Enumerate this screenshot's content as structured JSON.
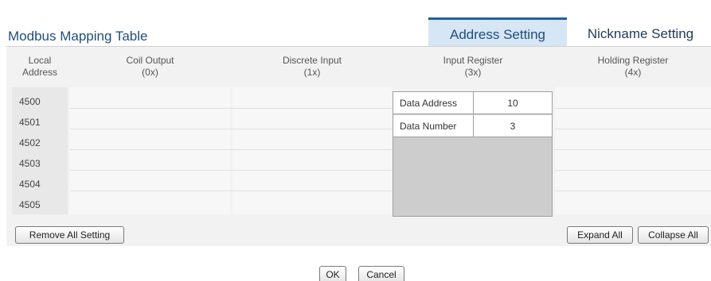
{
  "title": "Modbus Mapping Table",
  "tabs": [
    {
      "label": "Address Setting",
      "active": true
    },
    {
      "label": "Nickname Setting",
      "active": false
    }
  ],
  "columns": {
    "local": {
      "line1": "Local",
      "line2": "Address"
    },
    "coil": {
      "line1": "Coil Output",
      "line2": "(0x)"
    },
    "discrete": {
      "line1": "Discrete Input",
      "line2": "(1x)"
    },
    "input": {
      "line1": "Input Register",
      "line2": "(3x)"
    },
    "holding": {
      "line1": "Holding Register",
      "line2": "(4x)"
    }
  },
  "rows": [
    "4500",
    "4501",
    "4502",
    "4503",
    "4504",
    "4505"
  ],
  "input_register_config": {
    "data_address_label": "Data Address",
    "data_address_value": "10",
    "data_number_label": "Data Number",
    "data_number_value": "3"
  },
  "buttons": {
    "remove_all": "Remove All Setting",
    "expand_all": "Expand All",
    "collapse_all": "Collapse All",
    "ok": "OK",
    "cancel": "Cancel"
  },
  "colors": {
    "accent": "#1f5fa0",
    "active_tab_bg": "#d6e6f4",
    "title": "#1f4e79"
  }
}
